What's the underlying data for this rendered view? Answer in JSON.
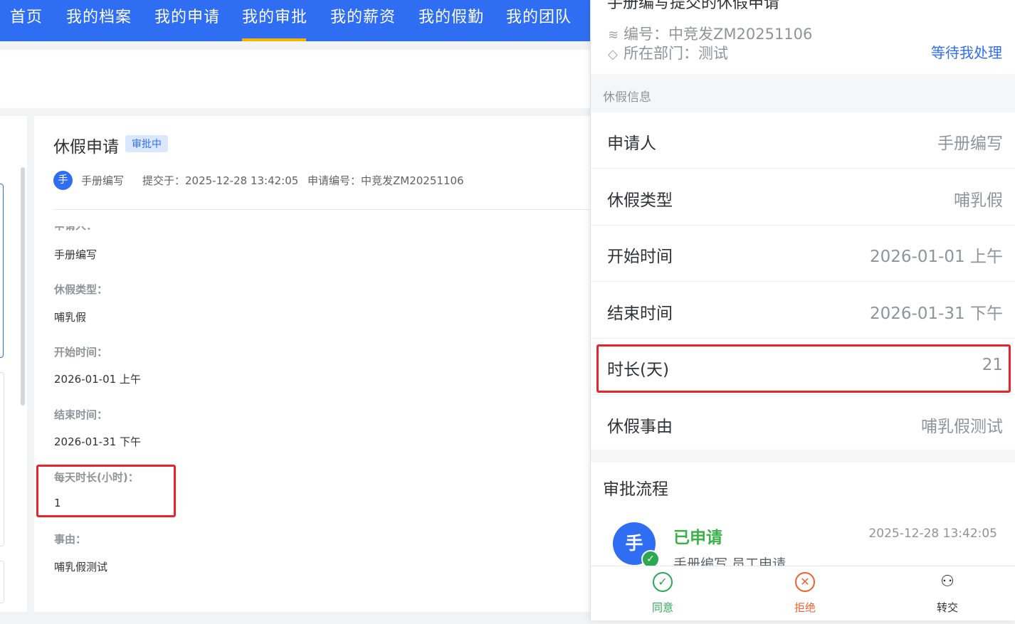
{
  "nav": {
    "tabs": [
      "首页",
      "我的档案",
      "我的申请",
      "我的审批",
      "我的薪资",
      "我的假勤",
      "我的团队"
    ],
    "active_index": 3
  },
  "detail": {
    "title": "休假申请",
    "status": "审批中",
    "avatar_char": "手",
    "applicant": "手册编写",
    "submitted": "提交于：2025-12-28 13:42:05",
    "number": "申请编号：中竞发ZM20251106",
    "fields": [
      {
        "label": "申请人：",
        "value": "手册编写"
      },
      {
        "label": "休假类型：",
        "value": "哺乳假"
      },
      {
        "label": "开始时间：",
        "value": "2026-01-01 上午"
      },
      {
        "label": "结束时间：",
        "value": "2026-01-31 下午"
      },
      {
        "label": "每天时长(小时)：",
        "value": "1"
      },
      {
        "label": "事由：",
        "value": "哺乳假测试"
      }
    ]
  },
  "panel": {
    "title": "手册编写提交的休假申请",
    "number": "编号：中竞发ZM20251106",
    "department": "所在部门：测试",
    "waiting": "等待我处理",
    "section": "休假信息",
    "rows": [
      {
        "k": "申请人",
        "v": "手册编写"
      },
      {
        "k": "休假类型",
        "v": "哺乳假"
      },
      {
        "k": "开始时间",
        "v": "2026-01-01 上午"
      },
      {
        "k": "结束时间",
        "v": "2026-01-31 下午"
      },
      {
        "k": "时长(天)",
        "v": "21"
      },
      {
        "k": "休假事由",
        "v": "哺乳假测试"
      }
    ],
    "flow": {
      "title": "审批流程",
      "avatar_char": "手",
      "step": "已申请",
      "time": "2025-12-28 13:42:05",
      "sub": "手册编写 员工申请"
    },
    "actions": [
      {
        "label": "同意",
        "icon": "check-circle-icon",
        "color": "#2ca853"
      },
      {
        "label": "拒绝",
        "icon": "x-circle-icon",
        "color": "#f0612e"
      },
      {
        "label": "转交",
        "icon": "transfer-user-icon",
        "color": "#303133"
      }
    ]
  },
  "colors": {
    "primary": "#2f6ef3",
    "highlight": "#e8252f",
    "active_underline": "#f5b300"
  }
}
